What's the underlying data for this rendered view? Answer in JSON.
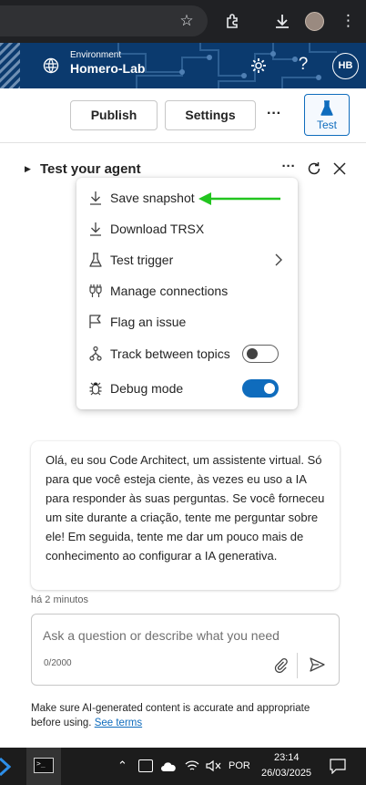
{
  "browser": {
    "icons": [
      "star-icon",
      "extensions-icon",
      "download-icon",
      "profile-avatar",
      "more-icon"
    ]
  },
  "header": {
    "environment_label": "Environment",
    "environment_name": "Homero-Lab",
    "avatar_initials": "HB",
    "brand_color": "#0b3a6e"
  },
  "command_bar": {
    "publish_label": "Publish",
    "settings_label": "Settings",
    "more_label": "···",
    "test_label": "Test",
    "accent_color": "#0f6cbd"
  },
  "panel": {
    "title": "Test your agent"
  },
  "menu": {
    "items": [
      {
        "label": "Save snapshot",
        "icon": "download-icon"
      },
      {
        "label": "Download TRSX",
        "icon": "download-icon"
      },
      {
        "label": "Test trigger",
        "icon": "flask-icon",
        "submenu": true
      },
      {
        "label": "Manage connections",
        "icon": "plug-icon"
      },
      {
        "label": "Flag an issue",
        "icon": "flag-icon"
      },
      {
        "label": "Track between topics",
        "icon": "track-icon",
        "toggle": false
      },
      {
        "label": "Debug mode",
        "icon": "bug-icon",
        "toggle": true
      }
    ],
    "annotation_arrow_color": "#22c51f"
  },
  "chat": {
    "bot_message": "Olá, eu sou Code Architect, um assistente virtual. Só para que você esteja ciente, às vezes eu uso a IA para responder às suas perguntas. Se você forneceu um site durante a criação, tente me perguntar sobre ele! Em seguida, tente me dar um pouco mais de conhecimento ao configurar a IA generativa.",
    "timestamp": "há 2 minutos",
    "input_placeholder": "Ask a question or describe what you need",
    "char_count": "0/2000",
    "disclaimer": "Make sure AI-generated content is accurate and appropriate before using.",
    "see_terms": "See terms"
  },
  "taskbar": {
    "language": "POR",
    "time": "23:14",
    "date": "26/03/2025"
  }
}
